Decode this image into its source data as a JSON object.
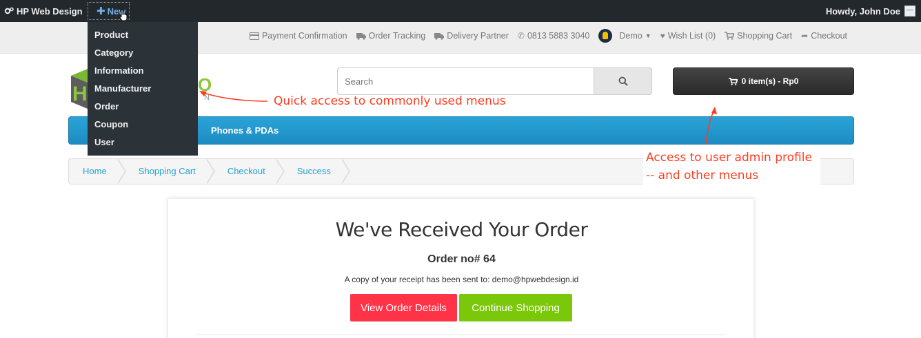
{
  "adminbar": {
    "site_name": "HP Web Design",
    "new_label": "New",
    "howdy": "Howdy, John Doe"
  },
  "new_menu": {
    "items": [
      "Product",
      "Category",
      "Information",
      "Manufacturer",
      "Order",
      "Coupon",
      "User"
    ]
  },
  "toplinks": {
    "payment": "Payment Confirmation",
    "order_tracking": "Order Tracking",
    "delivery": "Delivery Partner",
    "phone": "0813 5883 3040",
    "demo": "Demo",
    "wishlist": "Wish List (0)",
    "cart": "Shopping Cart",
    "checkout": "Checkout"
  },
  "logo": {
    "letter": "O",
    "sub": "N"
  },
  "search": {
    "placeholder": "Search"
  },
  "cart_button": "0 item(s) - Rp0",
  "menu": {
    "item": "Phones & PDAs"
  },
  "breadcrumb": [
    "Home",
    "Shopping Cart",
    "Checkout",
    "Success"
  ],
  "annotations": {
    "quick_access": "Quick access to commonly used menus",
    "user_admin_line1": "Access to user admin profile",
    "user_admin_line2": "-- and other menus"
  },
  "success": {
    "title": "We've Received Your Order",
    "order_no": "Order no# 64",
    "receipt": "A copy of your receipt has been sent to: demo@hpwebdesign.id",
    "view_button": "View Order Details",
    "continue_button": "Continue Shopping"
  },
  "colors": {
    "adminbar": "#23282d",
    "link": "#23a1d1",
    "menubar": "#229ac8",
    "view_button": "#ff3348",
    "continue_button": "#7bc70a",
    "annotation": "#ff3b1f"
  }
}
